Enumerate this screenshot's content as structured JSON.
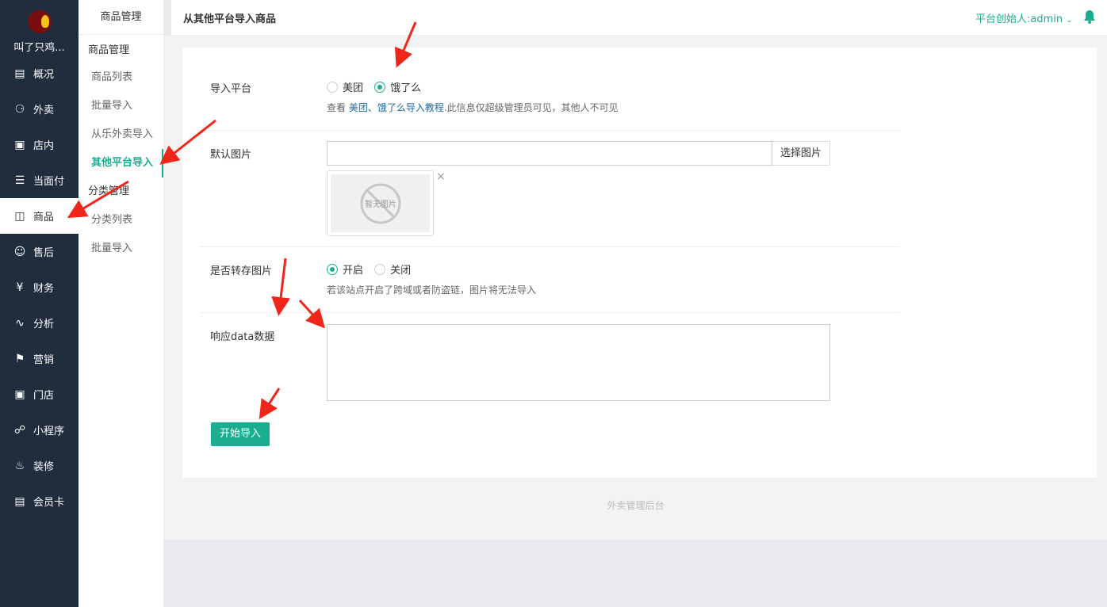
{
  "brand": {
    "name": "叫了只鸡..."
  },
  "sidebar": {
    "items": [
      {
        "label": "概况",
        "icon": "overview-icon"
      },
      {
        "label": "外卖",
        "icon": "delivery-icon"
      },
      {
        "label": "店内",
        "icon": "store-icon"
      },
      {
        "label": "当面付",
        "icon": "list-icon"
      },
      {
        "label": "商品",
        "icon": "bag-icon",
        "active": true
      },
      {
        "label": "售后",
        "icon": "aftersale-icon"
      },
      {
        "label": "财务",
        "icon": "yen-icon"
      },
      {
        "label": "分析",
        "icon": "trend-icon"
      },
      {
        "label": "营销",
        "icon": "flag-icon"
      },
      {
        "label": "门店",
        "icon": "shop-icon"
      },
      {
        "label": "小程序",
        "icon": "miniapp-icon"
      },
      {
        "label": "装修",
        "icon": "fire-icon"
      },
      {
        "label": "会员卡",
        "icon": "card-icon"
      }
    ]
  },
  "subnav": {
    "header": "商品管理",
    "group1": "商品管理",
    "items1": [
      "商品列表",
      "批量导入",
      "从乐外卖导入",
      "其他平台导入"
    ],
    "group2": "分类管理",
    "items2": [
      "分类列表",
      "批量导入"
    ]
  },
  "header": {
    "title": "从其他平台导入商品",
    "user": "平台创始人:admin"
  },
  "form": {
    "platform": {
      "label": "导入平台",
      "options": [
        "美团",
        "饿了么"
      ],
      "selected": "饿了么",
      "help_prefix": "查看",
      "help_link": "美团、饿了么导入教程",
      "help_suffix": ".此信息仅超级管理员可见，其他人不可见"
    },
    "default_image": {
      "label": "默认图片",
      "value": "",
      "button": "选择图片",
      "placeholder_text": "暂无图片",
      "remove": "×"
    },
    "transfer_image": {
      "label": "是否转存图片",
      "options": [
        "开启",
        "关闭"
      ],
      "selected": "开启",
      "help": "若该站点开启了跨域或者防盗链，图片将无法导入"
    },
    "response_data": {
      "label": "响应data数据",
      "value": ""
    },
    "submit": "开始导入"
  },
  "footer": {
    "text": "外卖管理后台"
  },
  "colors": {
    "accent": "#1aad8f",
    "sidebar": "#1f2d3d",
    "link": "#1b6aa5",
    "annotation": "#f0261b"
  }
}
